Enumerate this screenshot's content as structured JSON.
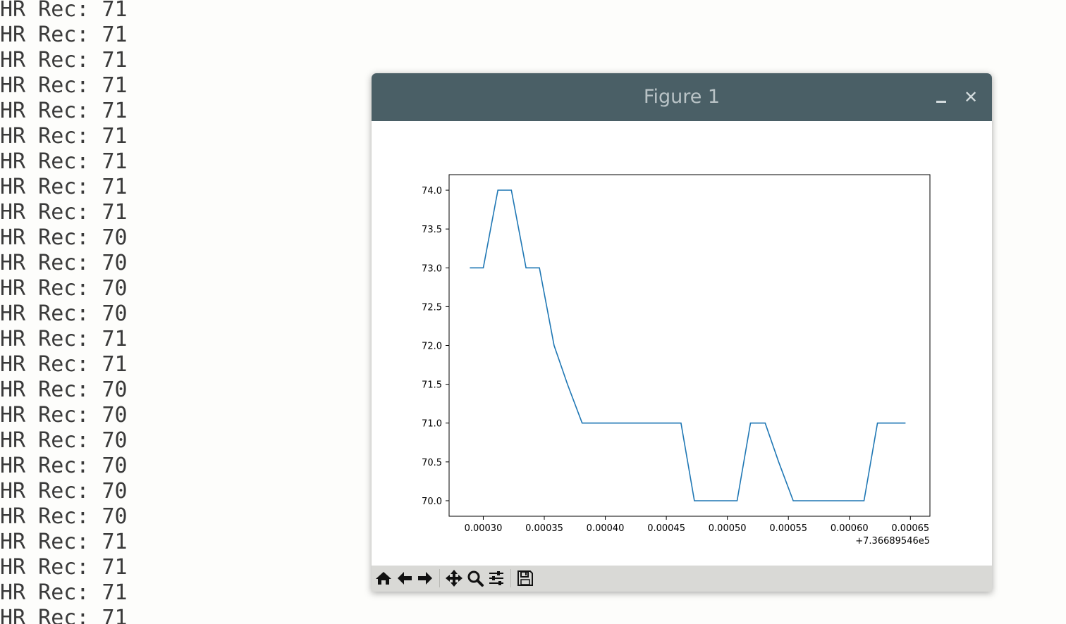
{
  "terminal": {
    "lines": [
      "HR Rec: 71",
      "HR Rec: 71",
      "HR Rec: 71",
      "HR Rec: 71",
      "HR Rec: 71",
      "HR Rec: 71",
      "HR Rec: 71",
      "HR Rec: 71",
      "HR Rec: 71",
      "HR Rec: 70",
      "HR Rec: 70",
      "HR Rec: 70",
      "HR Rec: 70",
      "HR Rec: 71",
      "HR Rec: 71",
      "HR Rec: 70",
      "HR Rec: 70",
      "HR Rec: 70",
      "HR Rec: 70",
      "HR Rec: 70",
      "HR Rec: 70",
      "HR Rec: 71",
      "HR Rec: 71",
      "HR Rec: 71",
      "HR Rec: 71"
    ]
  },
  "window": {
    "title": "Figure 1",
    "minimize_icon": "minimize-icon",
    "close_icon": "close-icon",
    "close_glyph": "✕"
  },
  "toolbar": {
    "buttons": [
      {
        "name": "home-button",
        "icon": "home-icon"
      },
      {
        "name": "back-button",
        "icon": "arrow-left-icon"
      },
      {
        "name": "forward-button",
        "icon": "arrow-right-icon"
      },
      {
        "name": "pan-button",
        "icon": "move-icon"
      },
      {
        "name": "zoom-button",
        "icon": "magnifier-icon"
      },
      {
        "name": "configure-subplots-button",
        "icon": "sliders-icon"
      },
      {
        "name": "save-button",
        "icon": "floppy-disk-icon"
      }
    ]
  },
  "chart_data": {
    "type": "line",
    "title": "",
    "xlabel": "",
    "ylabel": "",
    "x_offset_label": "+7.36689546e5",
    "xlim": [
      0.000272,
      0.000666
    ],
    "ylim": [
      69.8,
      74.2
    ],
    "xticks": [
      {
        "value": 0.0003,
        "label": "0.00030"
      },
      {
        "value": 0.00035,
        "label": "0.00035"
      },
      {
        "value": 0.0004,
        "label": "0.00040"
      },
      {
        "value": 0.00045,
        "label": "0.00045"
      },
      {
        "value": 0.0005,
        "label": "0.00050"
      },
      {
        "value": 0.00055,
        "label": "0.00055"
      },
      {
        "value": 0.0006,
        "label": "0.00060"
      },
      {
        "value": 0.00065,
        "label": "0.00065"
      }
    ],
    "yticks": [
      {
        "value": 70.0,
        "label": "70.0"
      },
      {
        "value": 70.5,
        "label": "70.5"
      },
      {
        "value": 71.0,
        "label": "71.0"
      },
      {
        "value": 71.5,
        "label": "71.5"
      },
      {
        "value": 72.0,
        "label": "72.0"
      },
      {
        "value": 72.5,
        "label": "72.5"
      },
      {
        "value": 73.0,
        "label": "73.0"
      },
      {
        "value": 73.5,
        "label": "73.5"
      },
      {
        "value": 74.0,
        "label": "74.0"
      }
    ],
    "grid": false,
    "series": [
      {
        "color": "#1f77b4",
        "x": [
          0.000289,
          0.0003,
          0.000312,
          0.000323,
          0.000335,
          0.000346,
          0.000358,
          0.000369,
          0.000381,
          0.000392,
          0.000404,
          0.000416,
          0.000427,
          0.000439,
          0.00045,
          0.000462,
          0.000473,
          0.000485,
          0.000496,
          0.000508,
          0.000519,
          0.000531,
          0.000542,
          0.000554,
          0.000565,
          0.000577,
          0.000589,
          0.0006,
          0.000612,
          0.000623,
          0.000635,
          0.000646
        ],
        "values": [
          73,
          73,
          74,
          74,
          73,
          73,
          72,
          71.5,
          71,
          71,
          71,
          71,
          71,
          71,
          71,
          71,
          70,
          70,
          70,
          70,
          71,
          71,
          70.5,
          70,
          70,
          70,
          70,
          70,
          70,
          71,
          71,
          71
        ]
      }
    ]
  }
}
